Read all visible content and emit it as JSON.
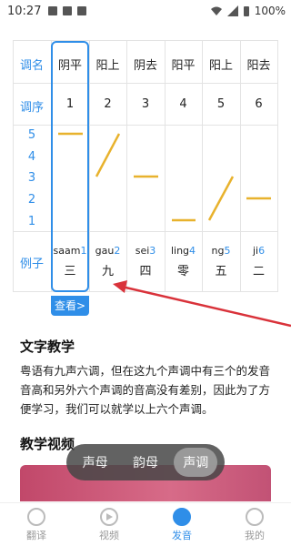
{
  "status_bar": {
    "time": "10:27",
    "battery": "100%"
  },
  "table": {
    "labels": {
      "name": "调名",
      "order": "调序",
      "example": "例子"
    },
    "tone_names": [
      "阴平",
      "阳上",
      "阴去",
      "阳平",
      "阳上",
      "阳去"
    ],
    "tone_orders": [
      "1",
      "2",
      "3",
      "4",
      "5",
      "6"
    ],
    "pitch_levels": [
      "5",
      "4",
      "3",
      "2",
      "1"
    ],
    "examples": [
      {
        "roman": "saam",
        "tone": "1",
        "char": "三"
      },
      {
        "roman": "gau",
        "tone": "2",
        "char": "九"
      },
      {
        "roman": "sei",
        "tone": "3",
        "char": "四"
      },
      {
        "roman": "ling",
        "tone": "4",
        "char": "零"
      },
      {
        "roman": "ng",
        "tone": "5",
        "char": "五"
      },
      {
        "roman": "ji",
        "tone": "6",
        "char": "二"
      }
    ],
    "check_button": "查看>"
  },
  "text_section": {
    "title": "文字教学",
    "paragraph": "粤语有九声六调，但在这九个声调中有三个的发音音高和另外六个声调的音高没有差别，因此为了方便学习，我们可以就学以上六个声调。"
  },
  "video_section": {
    "title": "教学视频"
  },
  "pill_tabs": {
    "items": [
      "声母",
      "韵母",
      "声调"
    ],
    "active": "声调"
  },
  "bottom_nav": {
    "items": [
      "翻译",
      "视频",
      "发音",
      "我的"
    ],
    "active": "发音"
  },
  "colors": {
    "accent": "#2f8ee8",
    "contour": "#e8b22d",
    "arrow": "#d9323a"
  }
}
